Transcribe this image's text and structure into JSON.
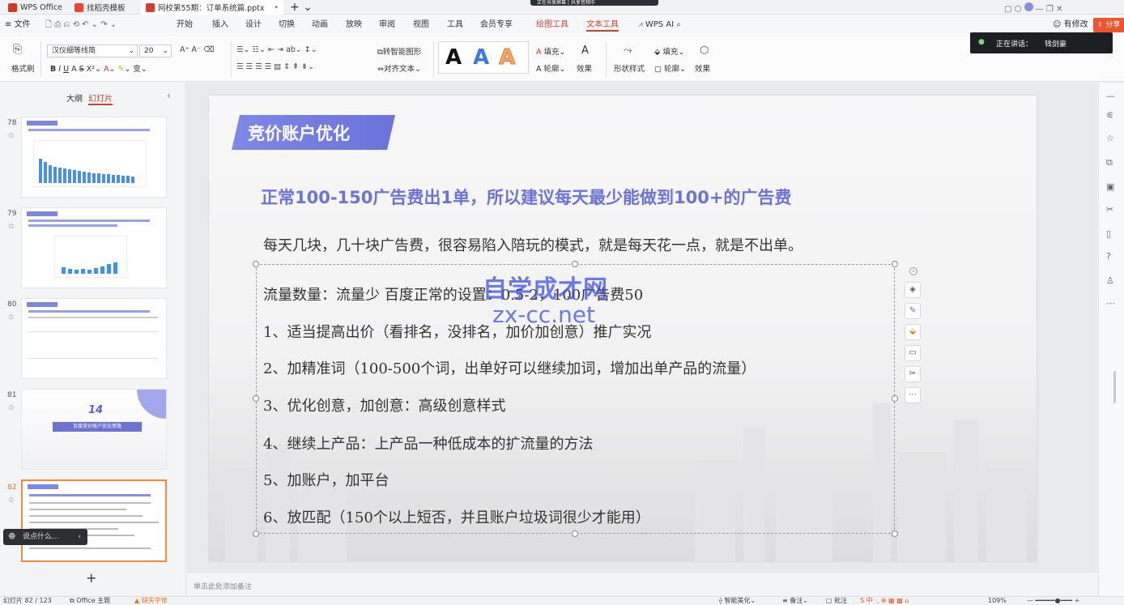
{
  "titlebar": {
    "tabs": [
      {
        "label": "WPS Office"
      },
      {
        "label": "找稻壳模板"
      },
      {
        "label": "网校第55期：订单系统篇.pptx"
      }
    ],
    "share_banner": "正在共享屏幕 | 共享音频中"
  },
  "menubar": {
    "items": [
      "文件",
      "开始",
      "插入",
      "设计",
      "切换",
      "动画",
      "放映",
      "审阅",
      "视图",
      "工具",
      "会员专享",
      "绘图工具",
      "文本工具",
      "WPS AI"
    ],
    "active": "文本工具",
    "right": {
      "modify": "有修改",
      "share": "分享"
    }
  },
  "ribbon": {
    "format_painter": "格式刷",
    "font_name": "汉仪细等线简",
    "font_size": "20",
    "text_tools": {
      "convert_shape": "转智能图形",
      "align_text": "对齐文本",
      "fill": "填充",
      "outline": "轮廓",
      "effect": "效果",
      "shape_style": "形状样式"
    },
    "style_letters": [
      "A",
      "A",
      "A"
    ]
  },
  "speaking": {
    "label": "正在讲话：",
    "name": "钱剑豪"
  },
  "sidebar": {
    "tab_outline": "大纲",
    "tab_slides": "幻灯片",
    "slides": [
      {
        "num": "78"
      },
      {
        "num": "79"
      },
      {
        "num": "80"
      },
      {
        "num": "81",
        "title_num": "14",
        "title_text": "百度竞价账户优化思路"
      },
      {
        "num": "82"
      }
    ],
    "add_btn": "+",
    "comment_prompt": "说点什么..."
  },
  "slide": {
    "heading": "竞价账户优化",
    "headline": "正常100-150广告费出1单，所以建议每天最少能做到100+的广告费",
    "lines": [
      "每天几块，几十块广告费，很容易陷入陪玩的模式，就是每天花一点，就是不出单。",
      "流量数量：流量少   百度正常的设置：0.5-2，100广告费50",
      "1、适当提高出价（看排名，没排名，加价加创意）推广实况",
      "2、加精准词（100-500个词，出单好可以继续加词，增加出单产品的流量）",
      "3、优化创意，加创意：高级创意样式",
      "4、继续上产品：上产品一种低成本的扩流量的方法",
      "5、加账户，加平台",
      "6、放匹配（150个以上短否，并且账户垃圾词很少才能用）"
    ],
    "watermark1": "自学成才网",
    "watermark2": "zx-cc.net"
  },
  "notes": {
    "placeholder": "单击此处添加备注"
  },
  "statusbar": {
    "slide_pos": "幻灯片 82 / 123",
    "theme": "Office 主题",
    "font_missing": "缺失字体",
    "smart": "智能美化",
    "notes_btn": "备注",
    "comment_btn": "批注",
    "zoom": "109%"
  },
  "colors": {
    "accent": "#d0402a",
    "brand_blue": "#6b73d6",
    "heading_bg": "#7d86e0"
  }
}
